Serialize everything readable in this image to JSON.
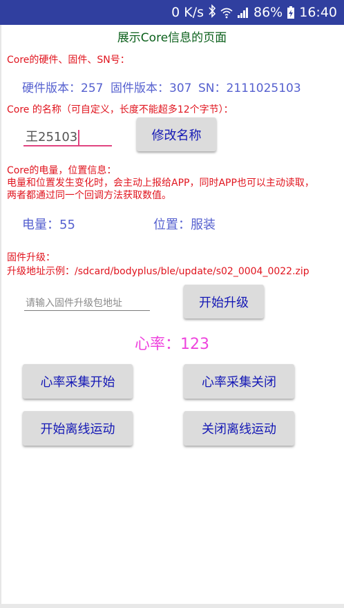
{
  "status_bar": {
    "speed": "0 K/s",
    "battery": "86%",
    "time": "16:40"
  },
  "page_title": "展示Core信息的页面",
  "hardware_section": {
    "label": "Core的硬件、固件、SN号：",
    "hardware_version": "硬件版本：257",
    "firmware_version": "固件版本：307",
    "sn": "SN：2111025103"
  },
  "name_section": {
    "label": "Core 的名称（可自定义，长度不能超多12个字节）：",
    "name_value": "王25103",
    "rename_button": "修改名称"
  },
  "battery_section": {
    "label_line1": "Core的电量，位置信息：",
    "label_line2": "电量和位置发生变化时，会主动上报给APP，同时APP也可以主动读取，",
    "label_line3": "两者都通过同一个回调方法获取数值。",
    "battery": "电量：55",
    "position": "位置：服装"
  },
  "firmware_upgrade": {
    "label_line1": "固件升级：",
    "label_line2": "升级地址示例：/sdcard/bodyplus/ble/update/s02_0004_0022.zip",
    "path_placeholder": "请输入固件升级包地址",
    "upgrade_button": "开始升级"
  },
  "heart_rate": {
    "value": "心率：123",
    "accent_color": "#ee44dd"
  },
  "buttons": {
    "hr_start": "心率采集开始",
    "hr_stop": "心率采集关闭",
    "offline_start": "开始离线运动",
    "offline_stop": "关闭离线运动"
  },
  "colors": {
    "status_bar": "#303F9F",
    "title": "#0a5f1a",
    "label_red": "#e0141e",
    "value_blue": "#5560cf",
    "button_text": "#1418b5",
    "edit_underline": "#e0437f"
  }
}
